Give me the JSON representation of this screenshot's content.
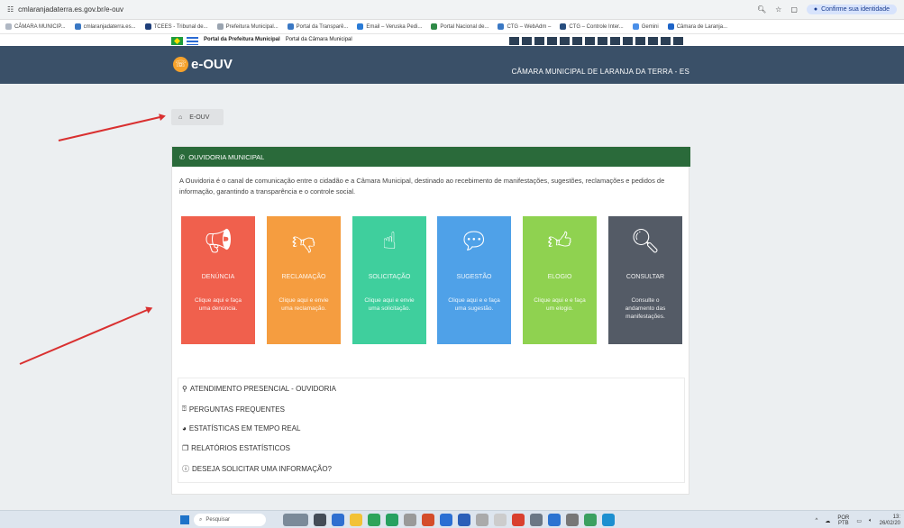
{
  "browser": {
    "url": "cmlaranjadaterra.es.gov.br/e-ouv",
    "identity_label": "Confirme sua identidade",
    "bookmarks": [
      "CÂMARA MUNICIP...",
      "cmlaranjadaterra.es...",
      "TCEES - Tribunal de...",
      "Prefeitura Municipal...",
      "Portal da Transparê...",
      "Email – Veruska Pedi...",
      "Portal Nacional de...",
      "CTG – WebAdm –",
      "CTG – Controle Inter...",
      "Gemini",
      "Câmara de Laranja..."
    ]
  },
  "govbar": {
    "link1": "Portal da Prefeitura Municipal",
    "link2": "Portal da Câmara Municipal"
  },
  "header": {
    "logo_text": "e-OUV",
    "title": "CÂMARA MUNICIPAL DE LARANJA DA TERRA - ES"
  },
  "breadcrumb": {
    "home_icon": "home-icon",
    "label": "E-OUV"
  },
  "panel": {
    "title": "OUVIDORIA MUNICIPAL",
    "intro": "A Ouvidoria é o canal de comunicação entre o cidadão e a Câmara Municipal, destinado ao recebimento de manifestações, sugestões, reclamações e pedidos de informação, garantindo a transparência e o controle social."
  },
  "tiles": [
    {
      "name": "DENÚNCIA",
      "desc": "Clique aqui e faça uma denúncia.",
      "color": "#f0604d",
      "icon": "megaphone-icon"
    },
    {
      "name": "RECLAMAÇÃO",
      "desc": "Clique aqui e envie uma reclamação.",
      "color": "#f59d40",
      "icon": "thumbs-down-icon"
    },
    {
      "name": "SOLICITAÇÃO",
      "desc": "Clique aqui e envie uma solicitação.",
      "color": "#3fcf9d",
      "icon": "hand-pointer-icon"
    },
    {
      "name": "SUGESTÃO",
      "desc": "Clique aqui e e faça uma sugestão.",
      "color": "#4fa1e8",
      "icon": "speech-bubble-icon"
    },
    {
      "name": "ELOGIO",
      "desc": "Clique aqui e e faça um elogio.",
      "color": "#8fd250",
      "icon": "thumbs-up-icon"
    },
    {
      "name": "CONSULTAR",
      "desc": "Consulte o andamento das manifestações.",
      "color": "#545b66",
      "icon": "magnifier-icon"
    }
  ],
  "links": [
    {
      "label": "ATENDIMENTO PRESENCIAL - OUVIDORIA",
      "icon": "map-marker-icon"
    },
    {
      "label": "PERGUNTAS FREQUENTES",
      "icon": "question-circle-icon"
    },
    {
      "label": "ESTATÍSTICAS EM TEMPO REAL",
      "icon": "pie-chart-icon"
    },
    {
      "label": "RELATÓRIOS ESTATÍSTICOS",
      "icon": "copy-icon"
    },
    {
      "label": "DESEJA SOLICITAR UMA INFORMAÇÃO?",
      "icon": "info-circle-icon"
    }
  ],
  "taskbar": {
    "search_placeholder": "Pesquisar",
    "lang": "POR",
    "lang2": "PTB",
    "time": "13:",
    "date": "26/02/20"
  }
}
